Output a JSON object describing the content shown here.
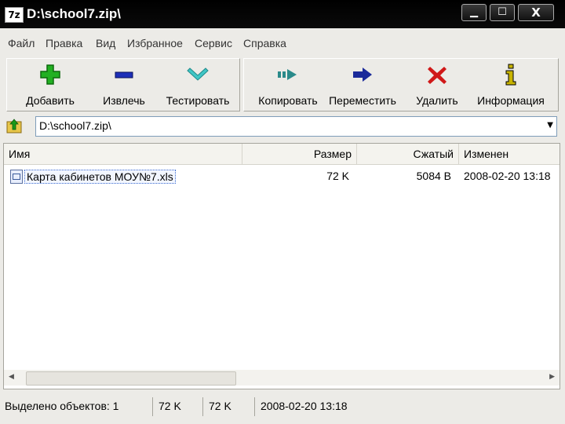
{
  "window": {
    "title": "D:\\school7.zip\\",
    "app_icon_label": "7z",
    "controls": {
      "minimize": "▁",
      "maximize": "☐",
      "close": "X"
    }
  },
  "menu": [
    "Файл",
    "Правка",
    "Вид",
    "Избранное",
    "Сервис",
    "Справка"
  ],
  "toolbar": {
    "buttons": [
      {
        "label": "Добавить",
        "icon": "plus-icon",
        "color": "#22b022"
      },
      {
        "label": "Извлечь",
        "icon": "minus-icon",
        "color": "#1e2fb8"
      },
      {
        "label": "Тестировать",
        "icon": "check-chevron-icon",
        "color": "#3fc6c6"
      },
      {
        "label": "Копировать",
        "icon": "copy-arrow-icon",
        "color": "#2a8a8a"
      },
      {
        "label": "Переместить",
        "icon": "move-arrow-icon",
        "color": "#1a2a9a"
      },
      {
        "label": "Удалить",
        "icon": "delete-x-icon",
        "color": "#d01818"
      },
      {
        "label": "Информация",
        "icon": "info-icon",
        "color": "#c8b400"
      }
    ]
  },
  "address": {
    "path": "D:\\school7.zip\\"
  },
  "columns": [
    "Имя",
    "Размер",
    "Сжатый",
    "Изменен"
  ],
  "files": [
    {
      "name": "Карта кабинетов МОУ№7.xls",
      "size": "72 K",
      "packed": "5084 B",
      "modified": "2008-02-20 13:18"
    }
  ],
  "status": {
    "selected": "Выделено объектов: 1",
    "size": "72 K",
    "packed": "72 K",
    "modified": "2008-02-20 13:18"
  }
}
